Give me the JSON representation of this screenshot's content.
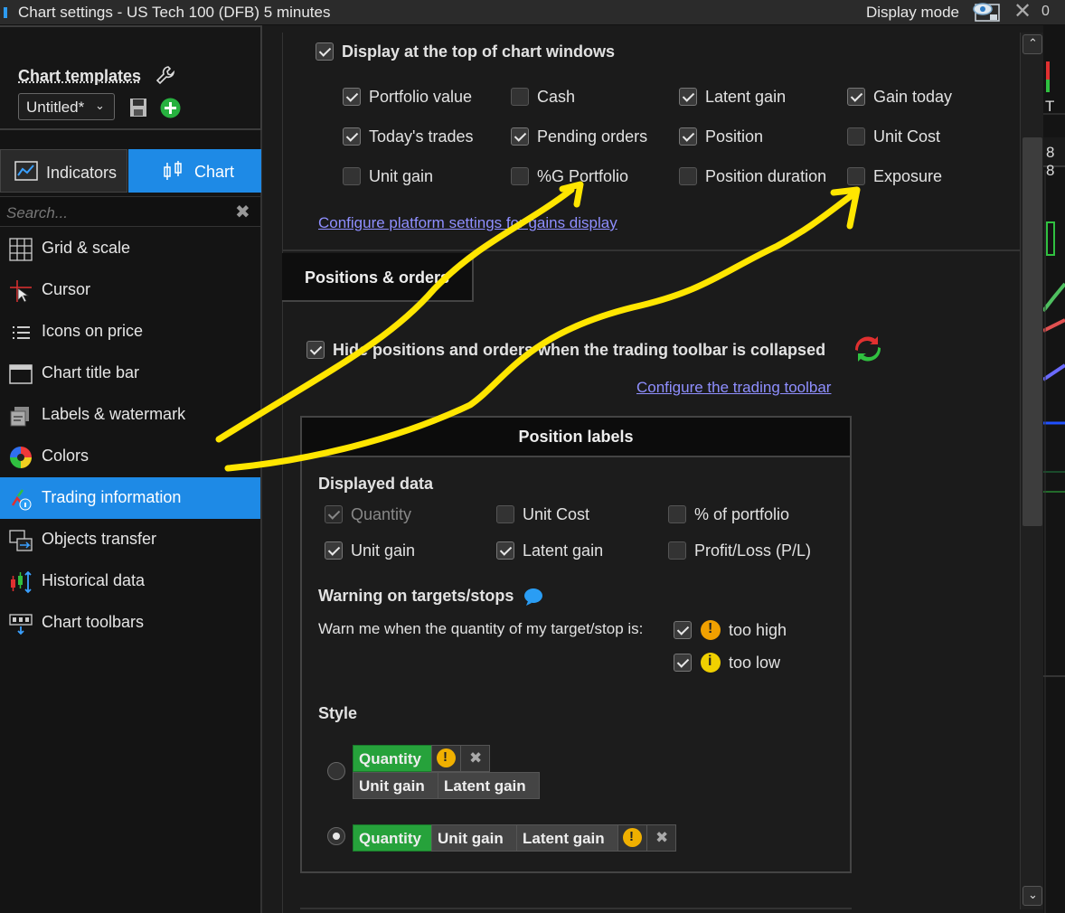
{
  "window": {
    "title": "Chart settings - US Tech 100 (DFB) 5 minutes",
    "display_mode": "Display mode"
  },
  "templates": {
    "label": "Chart templates",
    "selected": "Untitled*"
  },
  "tabs": {
    "indicators": "Indicators",
    "chart": "Chart"
  },
  "search": {
    "placeholder": "Search..."
  },
  "menu": [
    {
      "label": "Grid & scale",
      "icon": "grid-icon"
    },
    {
      "label": "Cursor",
      "icon": "cursor-icon"
    },
    {
      "label": "Icons on price",
      "icon": "list-icon"
    },
    {
      "label": "Chart title bar",
      "icon": "window-icon"
    },
    {
      "label": "Labels & watermark",
      "icon": "labels-icon"
    },
    {
      "label": "Colors",
      "icon": "color-wheel-icon"
    },
    {
      "label": "Trading information",
      "icon": "trading-info-icon",
      "active": true
    },
    {
      "label": "Objects transfer",
      "icon": "transfer-icon"
    },
    {
      "label": "Historical data",
      "icon": "candles-icon"
    },
    {
      "label": "Chart toolbars",
      "icon": "toolbar-icon"
    }
  ],
  "top_display": {
    "title": "Display at the top of chart windows",
    "options": [
      {
        "label": "Portfolio value",
        "checked": true
      },
      {
        "label": "Cash",
        "checked": false
      },
      {
        "label": "Latent gain",
        "checked": true
      },
      {
        "label": "Gain today",
        "checked": true
      },
      {
        "label": "Today's trades",
        "checked": true
      },
      {
        "label": "Pending orders",
        "checked": true
      },
      {
        "label": "Position",
        "checked": true
      },
      {
        "label": "Unit Cost",
        "checked": false
      },
      {
        "label": "Unit gain",
        "checked": false
      },
      {
        "label": "%G Portfolio",
        "checked": false
      },
      {
        "label": "Position duration",
        "checked": false
      },
      {
        "label": "Exposure",
        "checked": false
      }
    ],
    "link": "Configure platform settings for gains display"
  },
  "positions_tab": "Positions & orders",
  "hide_positions": {
    "label": "Hide positions and orders when the trading toolbar is collapsed",
    "checked": true,
    "link": "Configure the trading toolbar"
  },
  "position_labels": {
    "title": "Position labels",
    "displayed_data": "Displayed data",
    "options": [
      {
        "label": "Quantity",
        "checked": true,
        "disabled": true
      },
      {
        "label": "Unit Cost",
        "checked": false
      },
      {
        "label": "% of portfolio",
        "checked": false
      },
      {
        "label": "Unit gain",
        "checked": true
      },
      {
        "label": "Latent gain",
        "checked": true
      },
      {
        "label": "Profit/Loss (P/L)",
        "checked": false
      }
    ],
    "warning_title": "Warning on targets/stops",
    "warning_text": "Warn me when the quantity of my target/stop is:",
    "too_high": "too high",
    "too_low": "too low",
    "style_title": "Style",
    "style_chips": {
      "quantity": "Quantity",
      "unit_gain": "Unit gain",
      "latent_gain": "Latent gain"
    },
    "selected_style": 2
  },
  "chart_edge": {
    "t1": "0",
    "t2": "T",
    "t3": "8 8"
  },
  "colors": {
    "accent": "#1e8ae6",
    "chip_green": "#26a23b",
    "annotation": "#ffe600",
    "link": "#8f8fff"
  }
}
